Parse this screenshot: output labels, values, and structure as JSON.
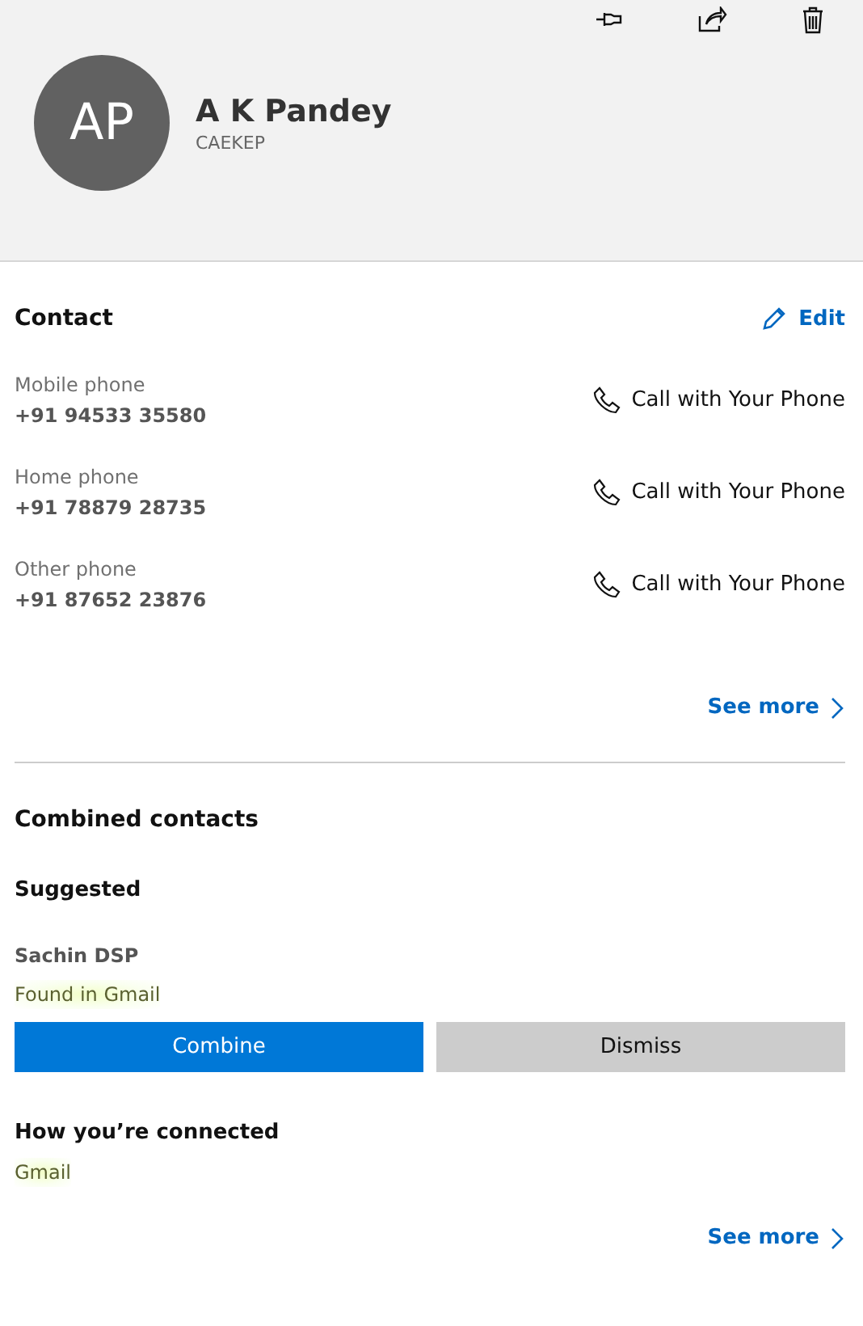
{
  "header": {
    "initials": "AP",
    "name": "A K Pandey",
    "subtitle": "CAEKEP"
  },
  "contact": {
    "title": "Contact",
    "edit": "Edit",
    "phones": [
      {
        "label": "Mobile phone",
        "number": "+91 94533 35580",
        "action": "Call with Your Phone"
      },
      {
        "label": "Home phone",
        "number": "+91 78879 28735",
        "action": "Call with Your Phone"
      },
      {
        "label": "Other phone",
        "number": "+91 87652 23876",
        "action": "Call with Your Phone"
      }
    ],
    "see_more": "See more"
  },
  "combined": {
    "title": "Combined contacts",
    "suggested_title": "Suggested",
    "suggestion_name": "Sachin DSP",
    "suggestion_source": "Found in Gmail",
    "buttons": [
      "Combine",
      "Dismiss"
    ],
    "connected_title": "How you’re connected",
    "connected_source": "Gmail",
    "see_more": "See more"
  }
}
